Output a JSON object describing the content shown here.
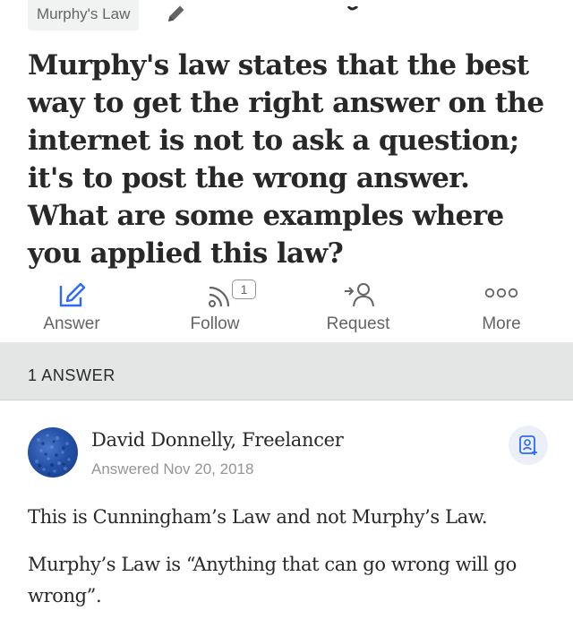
{
  "topic": {
    "label": "Murphy's Law"
  },
  "question": {
    "title": "Murphy's law states that the best way to get the right answer on the internet is not to ask a question; it's to post the wrong answer. What are some examples where you applied this law?"
  },
  "actions": [
    {
      "label": "Answer",
      "icon": "answer-pencil-icon"
    },
    {
      "label": "Follow",
      "icon": "follow-rss-icon",
      "badge": "1"
    },
    {
      "label": "Request",
      "icon": "request-person-icon"
    },
    {
      "label": "More",
      "icon": "more-dots-icon"
    }
  ],
  "answers_bar": {
    "count_label": "1 ANSWER"
  },
  "answer": {
    "author": "David Donnelly, Freelancer",
    "date": "Answered Nov 20, 2018",
    "paragraphs": [
      "This is Cunningham’s Law and not Murphy’s Law.",
      "Murphy’s Law is “Anything that can go wrong will go wrong”."
    ]
  },
  "colors": {
    "accent_blue": "#2e69ff",
    "muted_text": "#636466",
    "bar_background": "#e4e6e6"
  }
}
